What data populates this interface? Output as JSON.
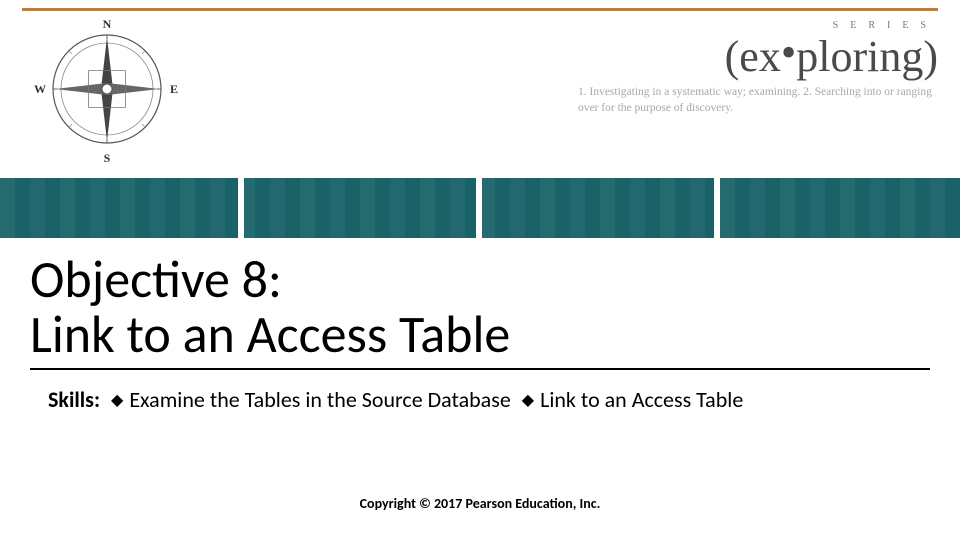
{
  "branding": {
    "series_label": "SERIES",
    "word_open": "(",
    "word_pre": "ex",
    "word_dot": "•",
    "word_post": "ploring",
    "word_close": ")",
    "definition": "1. Investigating in a systematic way; examining. 2. Searching into or ranging over for the purpose of discovery."
  },
  "compass": {
    "n": "N",
    "e": "E",
    "s": "S",
    "w": "W"
  },
  "title": {
    "line1": "Objective 8:",
    "line2": "Link to an Access Table"
  },
  "skills": {
    "label": "Skills:",
    "item1": "Examine the Tables in the Source Database",
    "item2": "Link to an Access Table"
  },
  "footer": {
    "copyright": "Copyright © 2017 Pearson Education, Inc."
  }
}
